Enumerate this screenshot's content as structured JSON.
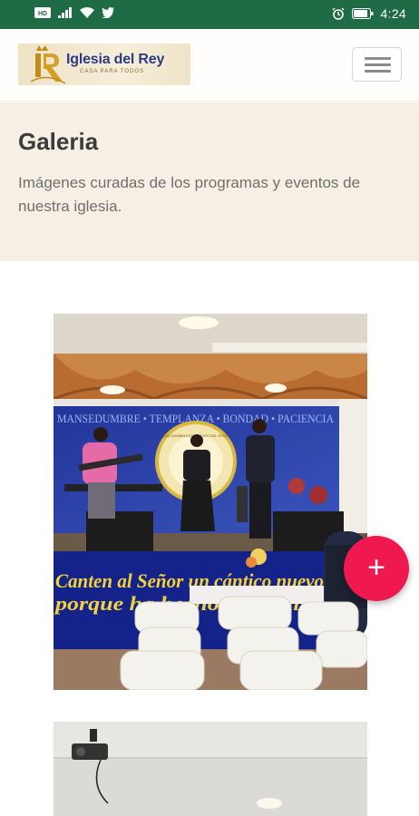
{
  "status_bar": {
    "icons_left": [
      "hd-icon",
      "signal-icon",
      "wifi-icon",
      "twitter-icon"
    ],
    "icons_right": [
      "alarm-icon",
      "battery-icon"
    ],
    "time": "4:24"
  },
  "navbar": {
    "logo": {
      "title": "Iglesia del Rey",
      "subtitle": "CASA PARA TODOS",
      "mark": "IR"
    },
    "menu_icon": "hamburger-icon"
  },
  "hero": {
    "title": "Galeria",
    "description": "Imágenes curadas de los programas y eventos de nuestra iglesia."
  },
  "gallery": {
    "photos": [
      {
        "banner_top": "MANSEDUMBRE • TEMPLANZA • BONDAD • PACIENCIA",
        "emblem_text": "LAS ASAMBLEAS DE DIOS DEL PERÚ",
        "banner_line1": "Canten al Señor un cántico nuevo",
        "banner_line2": "porque ha hecho maravillas"
      },
      {
        "alt": "church-interior-photo"
      }
    ]
  },
  "fab": {
    "label": "+"
  },
  "colors": {
    "status_bar": "#1f6b46",
    "hero_bg": "#f8efe4",
    "fab": "#f0194f",
    "logo_text": "#2a3a86"
  }
}
